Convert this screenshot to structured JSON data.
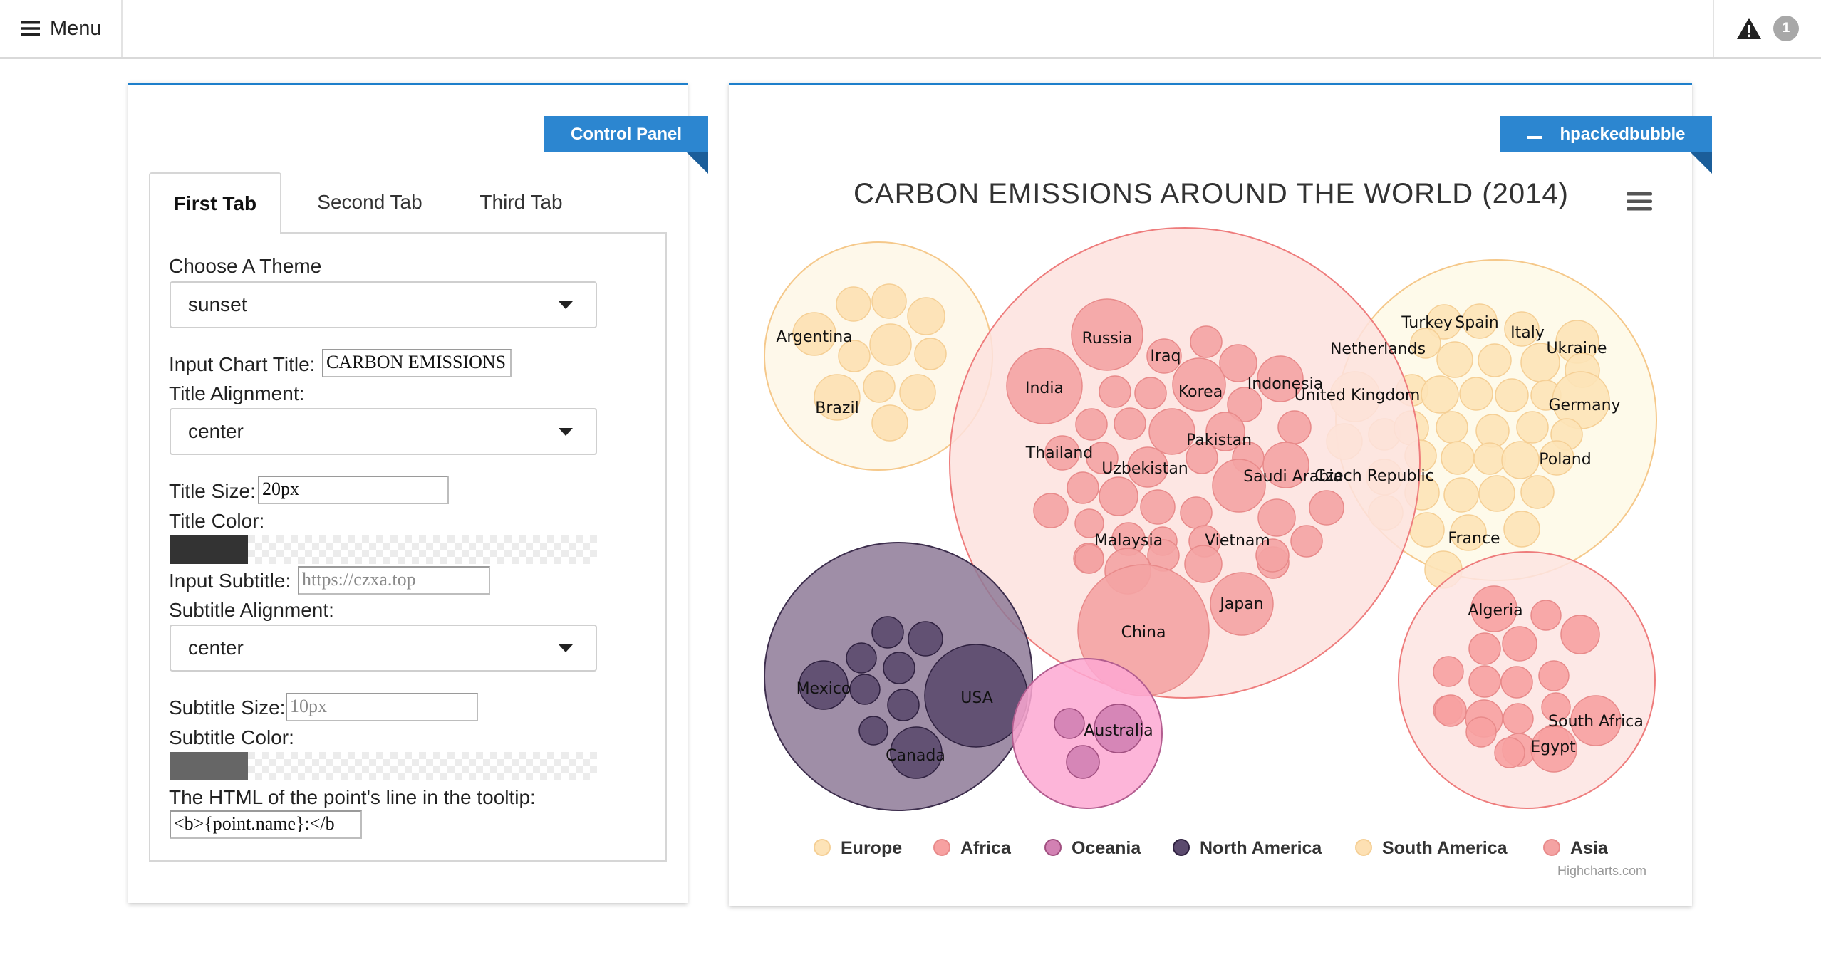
{
  "topbar": {
    "menu_label": "Menu",
    "alert_count": "1"
  },
  "left_panel": {
    "ribbon": "Control Panel",
    "tabs": [
      {
        "label": "First Tab",
        "active": true
      },
      {
        "label": "Second Tab",
        "active": false
      },
      {
        "label": "Third Tab",
        "active": false
      }
    ],
    "fields": {
      "theme_label": "Choose A Theme",
      "theme_value": "sunset",
      "title_label": "Input Chart Title:",
      "title_value": "CARBON EMISSIONS",
      "title_align_label": "Title Alignment:",
      "title_align_value": "center",
      "title_size_label": "Title Size:",
      "title_size_value": "20px",
      "title_color_label": "Title Color:",
      "title_color_value": "#333333",
      "subtitle_label": "Input Subtitle:",
      "subtitle_placeholder": "https://czxa.top",
      "subtitle_align_label": "Subtitle Alignment:",
      "subtitle_align_value": "center",
      "subtitle_size_label": "Subtitle Size:",
      "subtitle_size_placeholder": "10px",
      "subtitle_color_label": "Subtitle Color:",
      "subtitle_color_value": "#666666",
      "tooltip_label": "The HTML of the point's line in the tooltip:",
      "tooltip_value": "<b>{point.name}:</b"
    }
  },
  "right_panel": {
    "ribbon": "hpackedbubble",
    "credits": "Highcharts.com"
  },
  "chart_data": {
    "type": "packedbubble",
    "title": "CARBON EMISSIONS AROUND THE WORLD (2014)",
    "colors": {
      "Europe": "#fde3b7",
      "Africa": "#f7a1a1",
      "Oceania": "#d281b3",
      "North America": "#5b4a6e",
      "South America": "#fde0b3",
      "Asia": "#f4a3a3"
    },
    "legend": [
      "Europe",
      "Africa",
      "Oceania",
      "North America",
      "South America",
      "Asia"
    ],
    "series": [
      {
        "name": "Europe",
        "labels": [
          "Turkey",
          "Spain",
          "Italy",
          "Ukraine",
          "Netherlands",
          "United Kingdom",
          "Germany",
          "Poland",
          "Czech Republic",
          "France"
        ]
      },
      {
        "name": "Africa",
        "labels": [
          "Algeria",
          "South Africa",
          "Egypt"
        ]
      },
      {
        "name": "Oceania",
        "labels": [
          "Australia"
        ]
      },
      {
        "name": "North America",
        "labels": [
          "Mexico",
          "USA",
          "Canada"
        ]
      },
      {
        "name": "South America",
        "labels": [
          "Argentina",
          "Brazil"
        ]
      },
      {
        "name": "Asia",
        "labels": [
          "Russia",
          "Iraq",
          "India",
          "Korea",
          "Indonesia",
          "Thailand",
          "Pakistan",
          "Uzbekistan",
          "Saudi Arabia",
          "Malaysia",
          "Vietnam",
          "Japan",
          "China"
        ]
      }
    ]
  }
}
